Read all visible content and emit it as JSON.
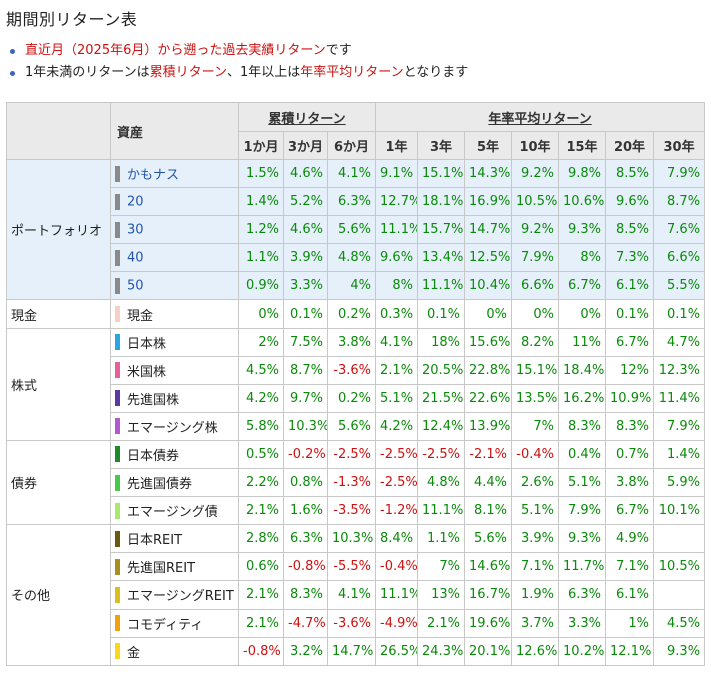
{
  "title": "期間別リターン表",
  "notes": [
    {
      "red": "直近月（2025年6月）から遡った過去実績リターン",
      "plain": "です"
    },
    {
      "p1": "1年未満のリターンは",
      "r1": "累積リターン",
      "p2": "、1年以上は",
      "r2": "年率平均リターン",
      "p3": "となります"
    }
  ],
  "header": {
    "asset": "資産",
    "cumulative": "累積リターン",
    "annual": "年率平均リターン",
    "periods": [
      "1か月",
      "3か月",
      "6か月",
      "1年",
      "3年",
      "5年",
      "10年",
      "15年",
      "20年",
      "30年"
    ]
  },
  "groups": [
    {
      "name": "ポートフォリオ",
      "portfolio": true,
      "rows": [
        {
          "name": "かもナス",
          "color": "#8a8a8a",
          "values": [
            "1.5%",
            "4.6%",
            "4.1%",
            "9.1%",
            "15.1%",
            "14.3%",
            "9.2%",
            "9.8%",
            "8.5%",
            "7.9%"
          ]
        },
        {
          "name": "20",
          "color": "#8a8a8a",
          "values": [
            "1.4%",
            "5.2%",
            "6.3%",
            "12.7%",
            "18.1%",
            "16.9%",
            "10.5%",
            "10.6%",
            "9.6%",
            "8.7%"
          ]
        },
        {
          "name": "30",
          "color": "#8a8a8a",
          "values": [
            "1.2%",
            "4.6%",
            "5.6%",
            "11.1%",
            "15.7%",
            "14.7%",
            "9.2%",
            "9.3%",
            "8.5%",
            "7.6%"
          ]
        },
        {
          "name": "40",
          "color": "#8a8a8a",
          "values": [
            "1.1%",
            "3.9%",
            "4.8%",
            "9.6%",
            "13.4%",
            "12.5%",
            "7.9%",
            "8%",
            "7.3%",
            "6.6%"
          ]
        },
        {
          "name": "50",
          "color": "#8a8a8a",
          "values": [
            "0.9%",
            "3.3%",
            "4%",
            "8%",
            "11.1%",
            "10.4%",
            "6.6%",
            "6.7%",
            "6.1%",
            "5.5%"
          ]
        }
      ]
    },
    {
      "name": "現金",
      "rows": [
        {
          "name": "現金",
          "color": "#f6d0c8",
          "values": [
            "0%",
            "0.1%",
            "0.2%",
            "0.3%",
            "0.1%",
            "0%",
            "0%",
            "0%",
            "0.1%",
            "0.1%"
          ]
        }
      ]
    },
    {
      "name": "株式",
      "rows": [
        {
          "name": "日本株",
          "color": "#2aa6e0",
          "values": [
            "2%",
            "7.5%",
            "3.8%",
            "4.1%",
            "18%",
            "15.6%",
            "8.2%",
            "11%",
            "6.7%",
            "4.7%"
          ]
        },
        {
          "name": "米国株",
          "color": "#e8609a",
          "values": [
            "4.5%",
            "8.7%",
            "-3.6%",
            "2.1%",
            "20.5%",
            "22.8%",
            "15.1%",
            "18.4%",
            "12%",
            "12.3%"
          ]
        },
        {
          "name": "先進国株",
          "color": "#5a3aa0",
          "values": [
            "4.2%",
            "9.7%",
            "0.2%",
            "5.1%",
            "21.5%",
            "22.6%",
            "13.5%",
            "16.2%",
            "10.9%",
            "11.4%"
          ]
        },
        {
          "name": "エマージング株",
          "color": "#b05ad0",
          "values": [
            "5.8%",
            "10.3%",
            "5.6%",
            "4.2%",
            "12.4%",
            "13.9%",
            "7%",
            "8.3%",
            "8.3%",
            "7.9%"
          ]
        }
      ]
    },
    {
      "name": "債券",
      "rows": [
        {
          "name": "日本債券",
          "color": "#1e8a2e",
          "values": [
            "0.5%",
            "-0.2%",
            "-2.5%",
            "-2.5%",
            "-2.5%",
            "-2.1%",
            "-0.4%",
            "0.4%",
            "0.7%",
            "1.4%"
          ]
        },
        {
          "name": "先進国債券",
          "color": "#4ac84a",
          "values": [
            "2.2%",
            "0.8%",
            "-1.3%",
            "-2.5%",
            "4.8%",
            "4.4%",
            "2.6%",
            "5.1%",
            "3.8%",
            "5.9%"
          ]
        },
        {
          "name": "エマージング債",
          "color": "#a8e86a",
          "values": [
            "2.1%",
            "1.6%",
            "-3.5%",
            "-1.2%",
            "11.1%",
            "8.1%",
            "5.1%",
            "7.9%",
            "6.7%",
            "10.1%"
          ]
        }
      ]
    },
    {
      "name": "その他",
      "rows": [
        {
          "name": "日本REIT",
          "color": "#6a5a10",
          "values": [
            "2.8%",
            "6.3%",
            "10.3%",
            "8.4%",
            "1.1%",
            "5.6%",
            "3.9%",
            "9.3%",
            "4.9%",
            ""
          ]
        },
        {
          "name": "先進国REIT",
          "color": "#a89020",
          "values": [
            "0.6%",
            "-0.8%",
            "-5.5%",
            "-0.4%",
            "7%",
            "14.6%",
            "7.1%",
            "11.7%",
            "7.1%",
            "10.5%"
          ]
        },
        {
          "name": "エマージングREIT",
          "color": "#d8c020",
          "values": [
            "2.1%",
            "8.3%",
            "4.1%",
            "11.1%",
            "13%",
            "16.7%",
            "1.9%",
            "6.3%",
            "6.1%",
            ""
          ]
        },
        {
          "name": "コモディティ",
          "color": "#f0a010",
          "values": [
            "2.1%",
            "-4.7%",
            "-3.6%",
            "-4.9%",
            "2.1%",
            "19.6%",
            "3.7%",
            "3.3%",
            "1%",
            "4.5%"
          ]
        },
        {
          "name": "金",
          "color": "#f8d818",
          "values": [
            "-0.8%",
            "3.2%",
            "14.7%",
            "26.5%",
            "24.3%",
            "20.1%",
            "12.6%",
            "10.2%",
            "12.1%",
            "9.3%"
          ]
        }
      ]
    }
  ]
}
